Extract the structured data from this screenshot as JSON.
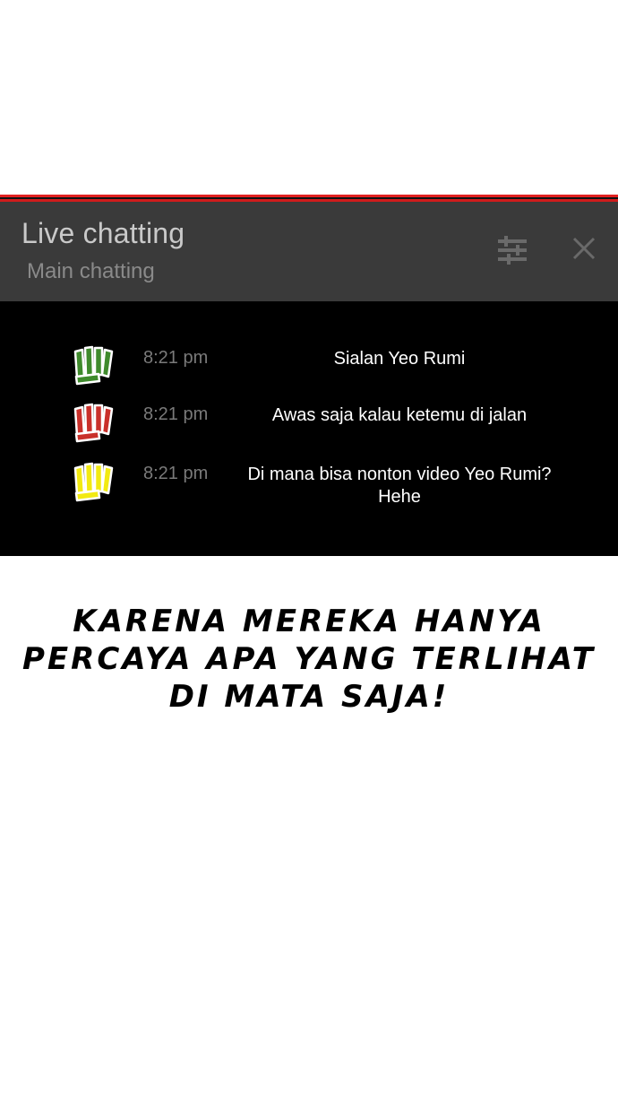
{
  "chat": {
    "title": "Live chatting",
    "subtitle": "Main chatting",
    "filter_icon": "filter-sliders-icon",
    "close_icon": "close-icon",
    "messages": [
      {
        "avatar_color": "#3f8a2c",
        "time": "8:21 pm",
        "text": "Sialan Yeo Rumi"
      },
      {
        "avatar_color": "#c9302a",
        "time": "8:21 pm",
        "text": "Awas saja kalau ketemu di jalan"
      },
      {
        "avatar_color": "#f2ea12",
        "time": "8:21 pm",
        "text": "Di mana bisa nonton video Yeo Rumi? Hehe"
      }
    ]
  },
  "caption": {
    "text": "KARENA MEREKA HANYA PERCAYA APA YANG TERLIHAT DI MATA SAJA!"
  }
}
